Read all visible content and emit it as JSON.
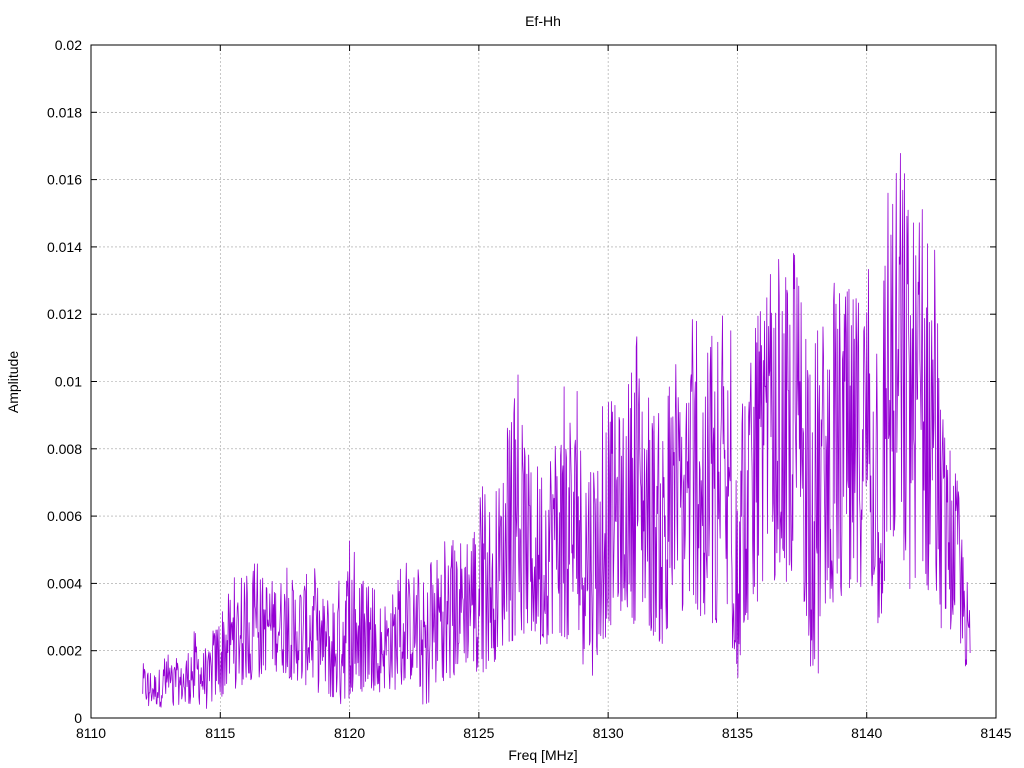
{
  "chart_data": {
    "type": "line",
    "title": "Ef-Hh",
    "xlabel": "Freq [MHz]",
    "ylabel": "Amplitude",
    "xlim": [
      8110,
      8145
    ],
    "ylim": [
      0,
      0.02
    ],
    "grid": true,
    "x_ticks": [
      "8110",
      "8115",
      "8120",
      "8125",
      "8130",
      "8135",
      "8140",
      "8145"
    ],
    "y_ticks": [
      "0",
      "0.002",
      "0.004",
      "0.006",
      "0.008",
      "0.01",
      "0.012",
      "0.014",
      "0.016",
      "0.018",
      "0.02"
    ],
    "series_color": "#9400d3",
    "series": [
      {
        "x": [
          8112.0,
          8112.5,
          8113.0,
          8113.5,
          8114.0,
          8114.5,
          8115.0,
          8115.5,
          8116.0,
          8116.5,
          8117.0,
          8117.5,
          8118.0,
          8118.5,
          8119.0,
          8119.5,
          8120.0,
          8120.5,
          8121.0,
          8121.5,
          8122.0,
          8122.5,
          8123.0,
          8123.5,
          8124.0,
          8124.5,
          8125.0,
          8125.5,
          8126.0,
          8126.5,
          8127.0,
          8127.5,
          8128.0,
          8128.5,
          8129.0,
          8129.5,
          8130.0,
          8130.5,
          8131.0,
          8131.5,
          8132.0,
          8132.5,
          8133.0,
          8133.5,
          8134.0,
          8134.5,
          8135.0,
          8135.5,
          8136.0,
          8136.5,
          8137.0,
          8137.5,
          8138.0,
          8138.5,
          8139.0,
          8139.5,
          8140.0,
          8140.5,
          8141.0,
          8141.5,
          8142.0,
          8142.5,
          8143.0,
          8143.5,
          8144.0
        ],
        "low": [
          0.0003,
          0.0003,
          0.0003,
          0.0004,
          0.0004,
          0.0002,
          0.0005,
          0.0008,
          0.001,
          0.0012,
          0.0014,
          0.0012,
          0.001,
          0.0008,
          0.0006,
          0.0003,
          0.0005,
          0.0007,
          0.0008,
          0.0007,
          0.0008,
          0.001,
          0.0001,
          0.001,
          0.0012,
          0.0014,
          0.0012,
          0.0015,
          0.002,
          0.0022,
          0.0023,
          0.002,
          0.0025,
          0.0018,
          0.0015,
          0.0012,
          0.0025,
          0.003,
          0.0028,
          0.0025,
          0.002,
          0.0025,
          0.0028,
          0.003,
          0.0025,
          0.0012,
          0.001,
          0.003,
          0.0035,
          0.004,
          0.0038,
          0.0035,
          0.0005,
          0.0035,
          0.003,
          0.0035,
          0.004,
          0.0018,
          0.005,
          0.0035,
          0.004,
          0.0028,
          0.0025,
          0.0025,
          0.0007
        ],
        "high": [
          0.0018,
          0.0015,
          0.002,
          0.0017,
          0.0029,
          0.002,
          0.0037,
          0.0042,
          0.0045,
          0.0047,
          0.0045,
          0.0046,
          0.0045,
          0.0048,
          0.004,
          0.0045,
          0.0055,
          0.0042,
          0.0038,
          0.004,
          0.0045,
          0.0048,
          0.0045,
          0.0057,
          0.0055,
          0.0062,
          0.0068,
          0.0072,
          0.0082,
          0.0104,
          0.0082,
          0.0085,
          0.0095,
          0.0105,
          0.0092,
          0.009,
          0.0105,
          0.0098,
          0.012,
          0.011,
          0.0097,
          0.0102,
          0.0118,
          0.0128,
          0.0115,
          0.0122,
          0.0122,
          0.0115,
          0.0128,
          0.0135,
          0.0145,
          0.0148,
          0.013,
          0.0132,
          0.0142,
          0.0138,
          0.0142,
          0.0145,
          0.0178,
          0.0182,
          0.0155,
          0.0162,
          0.0085,
          0.0078,
          0.0035
        ]
      }
    ]
  }
}
